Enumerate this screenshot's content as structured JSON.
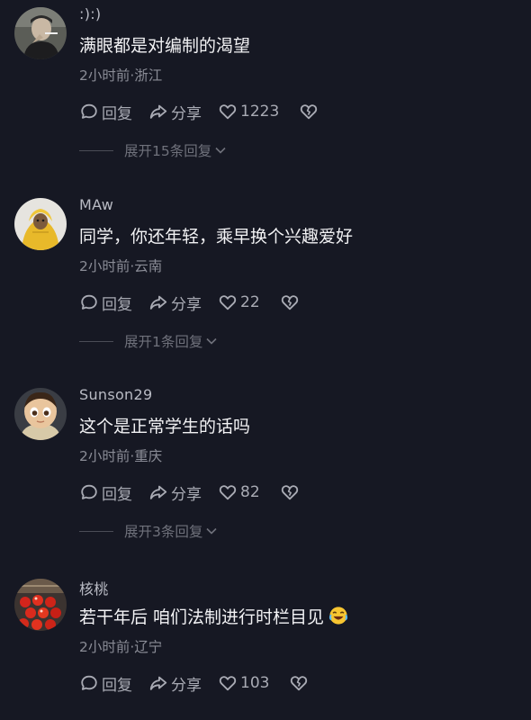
{
  "comments": [
    {
      "username": ":):)",
      "text": "满眼都是对编制的渴望",
      "meta": "2小时前·浙江",
      "reply_label": "回复",
      "share_label": "分享",
      "likes": "1223",
      "expand": "展开15条回复",
      "avatar": "man-smoking-avatar"
    },
    {
      "username": "MAw",
      "text": "同学，你还年轻，乘早换个兴趣爱好",
      "meta": "2小时前·云南",
      "reply_label": "回复",
      "share_label": "分享",
      "likes": "22",
      "expand": "展开1条回复",
      "avatar": "yellow-raincoat-avatar"
    },
    {
      "username": "Sunson29",
      "text": "这个是正常学生的话吗",
      "meta": "2小时前·重庆",
      "reply_label": "回复",
      "share_label": "分享",
      "likes": "82",
      "expand": "展开3条回复",
      "avatar": "cartoon-girl-avatar"
    },
    {
      "username": "核桃",
      "text": "若干年后 咱们法制进行时栏目见",
      "meta": "2小时前·辽宁",
      "reply_label": "回复",
      "share_label": "分享",
      "likes": "103",
      "avatar": "candied-haws-avatar",
      "emoji": "laughing-crying-emoji"
    }
  ],
  "colors": {
    "background": "#161823",
    "primary_text": "#f2f2f4",
    "secondary_text": "#8a8c96",
    "icon": "#a9abb4"
  }
}
